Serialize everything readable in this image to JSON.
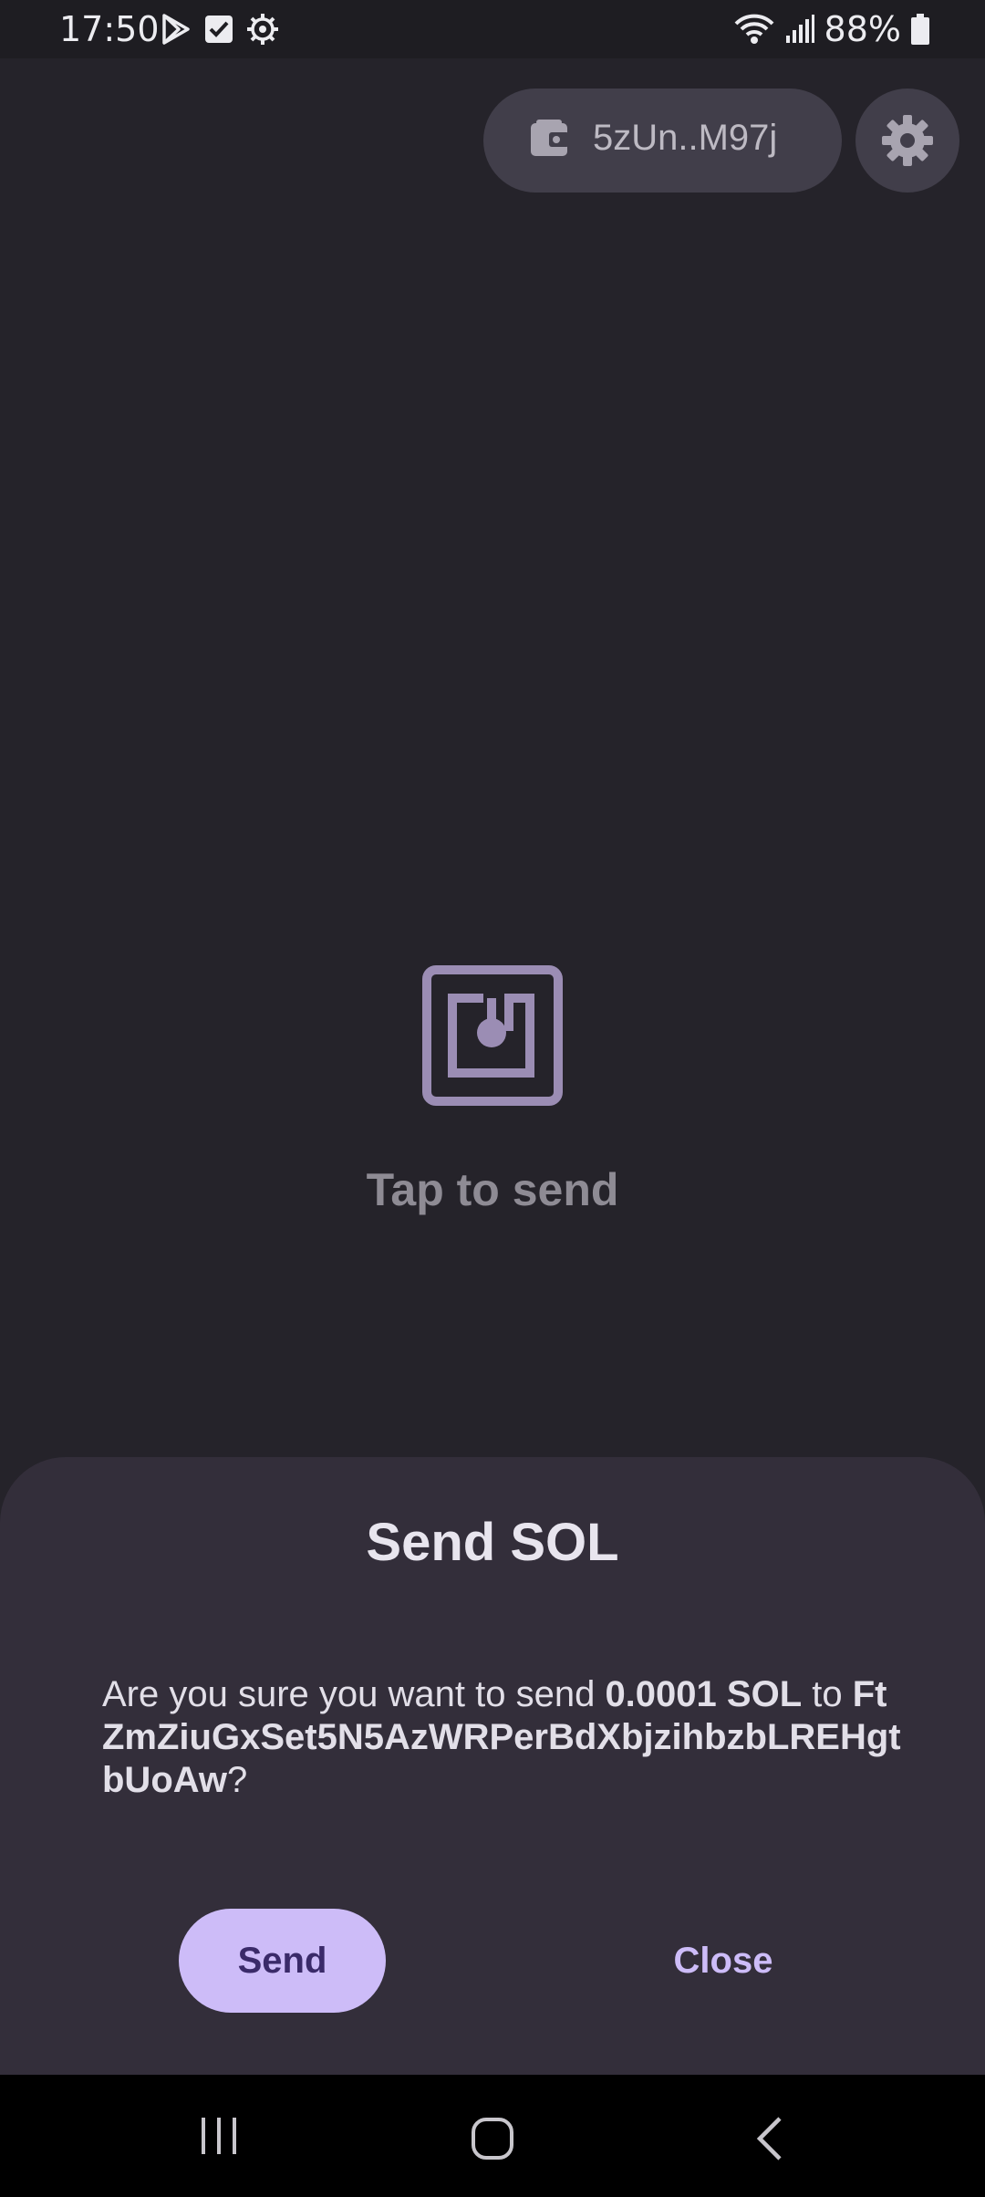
{
  "status_bar": {
    "time": "17:50",
    "battery_percent": "88%",
    "icons_left": [
      "play-store-icon",
      "checkbox-icon",
      "gear-outline-icon"
    ],
    "icons_right": [
      "wifi-icon",
      "signal-icon",
      "battery-icon"
    ]
  },
  "top_bar": {
    "wallet_address": "5zUn..M97j",
    "wallet_icon": "wallet-icon",
    "settings_icon": "gear-icon"
  },
  "center": {
    "icon": "nfc-icon",
    "label": "Tap to send"
  },
  "dialog": {
    "title": "Send SOL",
    "message_prefix": "Are you sure you want to send ",
    "amount": "0.0001 SOL",
    "message_mid": " to ",
    "recipient": "FtZmZiuGxSet5N5AzWRPerBdXbjzihbzbLREHgtbUoAw",
    "message_suffix": "?",
    "send_label": "Send",
    "close_label": "Close"
  },
  "colors": {
    "background": "#25232a",
    "sheet": "#332e3a",
    "pill": "#413e4a",
    "accent": "#cdbcf8",
    "accent_text": "#3a2a69",
    "icon_purple": "#9b8db4"
  },
  "nav_bar": {
    "items": [
      "recent-apps-icon",
      "home-icon",
      "back-icon"
    ]
  }
}
